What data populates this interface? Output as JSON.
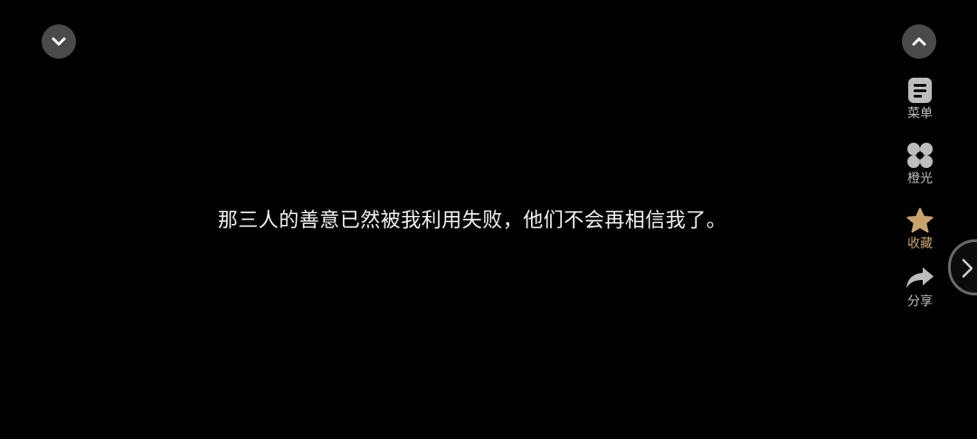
{
  "top_left_button": {
    "icon": "chevron-down-icon"
  },
  "top_right_button": {
    "icon": "chevron-up-icon"
  },
  "dialogue": {
    "text": "那三人的善意已然被我利用失败，他们不会再相信我了。"
  },
  "side_menu": {
    "items": [
      {
        "label": "菜单",
        "icon": "menu-doc-icon"
      },
      {
        "label": "橙光",
        "icon": "orange-light-logo-icon"
      },
      {
        "label": "收藏",
        "icon": "star-icon",
        "active_color": "#c9a46a"
      },
      {
        "label": "分享",
        "icon": "share-icon"
      }
    ]
  },
  "next_tab": {
    "icon": "chevron-right-icon"
  },
  "colors": {
    "background": "#000000",
    "button_bg": "#4a4a4a",
    "text": "#f2f2f2",
    "label": "#bdbdbd",
    "favorite": "#c9a46a"
  }
}
